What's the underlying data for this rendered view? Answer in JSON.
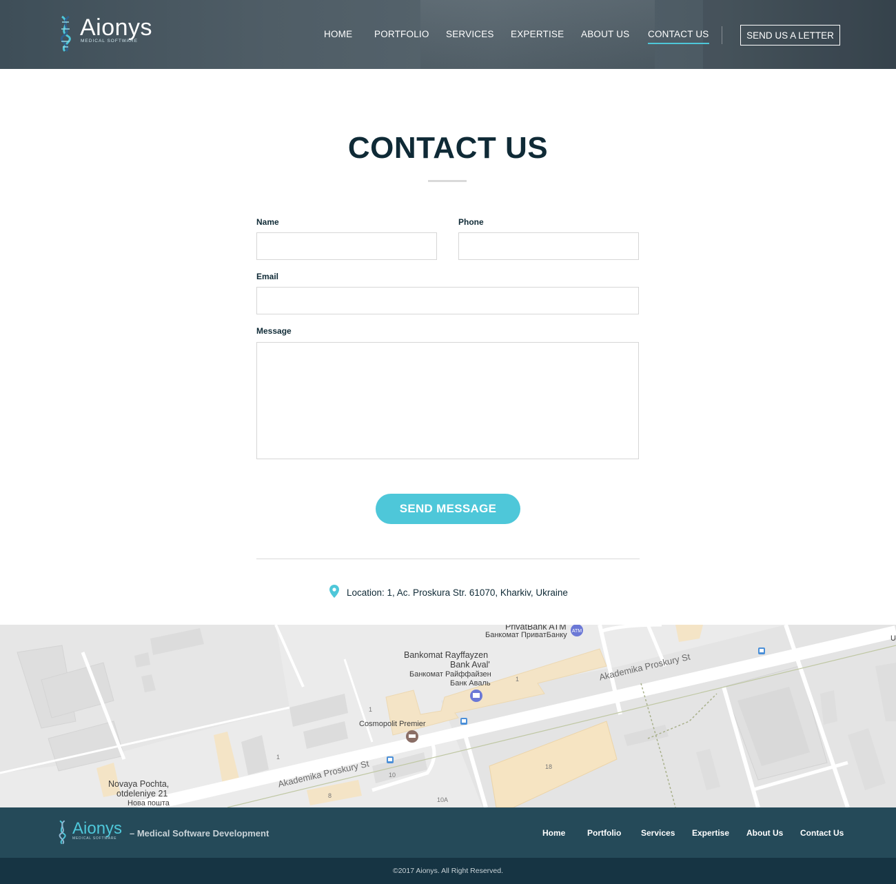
{
  "header": {
    "logo": {
      "name": "Aionys",
      "subtitle": "MEDICAL SOFTWARE"
    },
    "nav": [
      {
        "label": "HOME"
      },
      {
        "label": "PORTFOLIO"
      },
      {
        "label": "SERVICES"
      },
      {
        "label": "EXPERTISE"
      },
      {
        "label": "ABOUT US"
      },
      {
        "label": "CONTACT US",
        "active": true
      }
    ],
    "cta_label": "SEND US A LETTER"
  },
  "contact": {
    "title": "CONTACT US",
    "fields": {
      "name_label": "Name",
      "name_value": "",
      "phone_label": "Phone",
      "phone_value": "",
      "email_label": "Email",
      "email_value": "",
      "message_label": "Message",
      "message_value": ""
    },
    "submit_label": "SEND MESSAGE",
    "location": "Location: 1, Ac. Proskura Str. 61070, Kharkiv, Ukraine"
  },
  "map": {
    "labels": {
      "privatbank": "PrivatBank ATM",
      "privatbank_ru": "Банкомат ПриватБанку",
      "raif_1": "Bankomat Rayffayzen",
      "raif_2": "Bank Aval'",
      "raif_ru_1": "Банкомат Райффайзен",
      "raif_ru_2": "Банк Аваль",
      "cosmopolit": "Cosmopolit Premier",
      "novaya_1": "Novaya Pochta,",
      "novaya_2": "otdeleniye 21",
      "novaya_ru": "Нова пошта",
      "street_1": "Akademika Proskury St",
      "street_2": "Akademika Proskury St",
      "edge": "U"
    },
    "numbers": {
      "n1a": "1",
      "n1b": "1",
      "n1c": "1",
      "n10": "10",
      "n8": "8",
      "n10a": "10A",
      "n18": "18"
    },
    "icon_labels": {
      "atm": "ATM"
    }
  },
  "footer": {
    "logo_name": "Aionys",
    "logo_subtitle": "MEDICAL SOFTWARE",
    "tagline": "– Medical Software Development",
    "links": [
      {
        "label": "Home"
      },
      {
        "label": "Portfolio"
      },
      {
        "label": "Services"
      },
      {
        "label": "Expertise"
      },
      {
        "label": "About Us"
      },
      {
        "label": "Contact Us"
      }
    ],
    "copyright": "©2017 Aionys. All Right Reserved."
  },
  "colors": {
    "accent": "#4ec7d9",
    "dark": "#0f2a36",
    "footer": "#254a59",
    "footer_bottom": "#163443"
  }
}
